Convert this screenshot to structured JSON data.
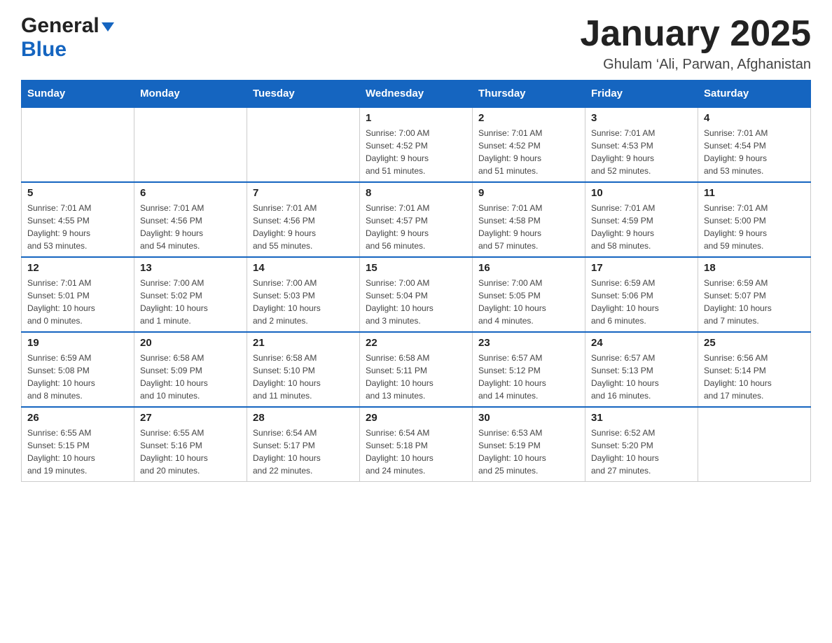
{
  "header": {
    "logo_general": "General",
    "logo_blue": "Blue",
    "month_title": "January 2025",
    "location": "Ghulam ‘Ali, Parwan, Afghanistan"
  },
  "days_of_week": [
    "Sunday",
    "Monday",
    "Tuesday",
    "Wednesday",
    "Thursday",
    "Friday",
    "Saturday"
  ],
  "weeks": [
    [
      {
        "day": "",
        "info": ""
      },
      {
        "day": "",
        "info": ""
      },
      {
        "day": "",
        "info": ""
      },
      {
        "day": "1",
        "info": "Sunrise: 7:00 AM\nSunset: 4:52 PM\nDaylight: 9 hours\nand 51 minutes."
      },
      {
        "day": "2",
        "info": "Sunrise: 7:01 AM\nSunset: 4:52 PM\nDaylight: 9 hours\nand 51 minutes."
      },
      {
        "day": "3",
        "info": "Sunrise: 7:01 AM\nSunset: 4:53 PM\nDaylight: 9 hours\nand 52 minutes."
      },
      {
        "day": "4",
        "info": "Sunrise: 7:01 AM\nSunset: 4:54 PM\nDaylight: 9 hours\nand 53 minutes."
      }
    ],
    [
      {
        "day": "5",
        "info": "Sunrise: 7:01 AM\nSunset: 4:55 PM\nDaylight: 9 hours\nand 53 minutes."
      },
      {
        "day": "6",
        "info": "Sunrise: 7:01 AM\nSunset: 4:56 PM\nDaylight: 9 hours\nand 54 minutes."
      },
      {
        "day": "7",
        "info": "Sunrise: 7:01 AM\nSunset: 4:56 PM\nDaylight: 9 hours\nand 55 minutes."
      },
      {
        "day": "8",
        "info": "Sunrise: 7:01 AM\nSunset: 4:57 PM\nDaylight: 9 hours\nand 56 minutes."
      },
      {
        "day": "9",
        "info": "Sunrise: 7:01 AM\nSunset: 4:58 PM\nDaylight: 9 hours\nand 57 minutes."
      },
      {
        "day": "10",
        "info": "Sunrise: 7:01 AM\nSunset: 4:59 PM\nDaylight: 9 hours\nand 58 minutes."
      },
      {
        "day": "11",
        "info": "Sunrise: 7:01 AM\nSunset: 5:00 PM\nDaylight: 9 hours\nand 59 minutes."
      }
    ],
    [
      {
        "day": "12",
        "info": "Sunrise: 7:01 AM\nSunset: 5:01 PM\nDaylight: 10 hours\nand 0 minutes."
      },
      {
        "day": "13",
        "info": "Sunrise: 7:00 AM\nSunset: 5:02 PM\nDaylight: 10 hours\nand 1 minute."
      },
      {
        "day": "14",
        "info": "Sunrise: 7:00 AM\nSunset: 5:03 PM\nDaylight: 10 hours\nand 2 minutes."
      },
      {
        "day": "15",
        "info": "Sunrise: 7:00 AM\nSunset: 5:04 PM\nDaylight: 10 hours\nand 3 minutes."
      },
      {
        "day": "16",
        "info": "Sunrise: 7:00 AM\nSunset: 5:05 PM\nDaylight: 10 hours\nand 4 minutes."
      },
      {
        "day": "17",
        "info": "Sunrise: 6:59 AM\nSunset: 5:06 PM\nDaylight: 10 hours\nand 6 minutes."
      },
      {
        "day": "18",
        "info": "Sunrise: 6:59 AM\nSunset: 5:07 PM\nDaylight: 10 hours\nand 7 minutes."
      }
    ],
    [
      {
        "day": "19",
        "info": "Sunrise: 6:59 AM\nSunset: 5:08 PM\nDaylight: 10 hours\nand 8 minutes."
      },
      {
        "day": "20",
        "info": "Sunrise: 6:58 AM\nSunset: 5:09 PM\nDaylight: 10 hours\nand 10 minutes."
      },
      {
        "day": "21",
        "info": "Sunrise: 6:58 AM\nSunset: 5:10 PM\nDaylight: 10 hours\nand 11 minutes."
      },
      {
        "day": "22",
        "info": "Sunrise: 6:58 AM\nSunset: 5:11 PM\nDaylight: 10 hours\nand 13 minutes."
      },
      {
        "day": "23",
        "info": "Sunrise: 6:57 AM\nSunset: 5:12 PM\nDaylight: 10 hours\nand 14 minutes."
      },
      {
        "day": "24",
        "info": "Sunrise: 6:57 AM\nSunset: 5:13 PM\nDaylight: 10 hours\nand 16 minutes."
      },
      {
        "day": "25",
        "info": "Sunrise: 6:56 AM\nSunset: 5:14 PM\nDaylight: 10 hours\nand 17 minutes."
      }
    ],
    [
      {
        "day": "26",
        "info": "Sunrise: 6:55 AM\nSunset: 5:15 PM\nDaylight: 10 hours\nand 19 minutes."
      },
      {
        "day": "27",
        "info": "Sunrise: 6:55 AM\nSunset: 5:16 PM\nDaylight: 10 hours\nand 20 minutes."
      },
      {
        "day": "28",
        "info": "Sunrise: 6:54 AM\nSunset: 5:17 PM\nDaylight: 10 hours\nand 22 minutes."
      },
      {
        "day": "29",
        "info": "Sunrise: 6:54 AM\nSunset: 5:18 PM\nDaylight: 10 hours\nand 24 minutes."
      },
      {
        "day": "30",
        "info": "Sunrise: 6:53 AM\nSunset: 5:19 PM\nDaylight: 10 hours\nand 25 minutes."
      },
      {
        "day": "31",
        "info": "Sunrise: 6:52 AM\nSunset: 5:20 PM\nDaylight: 10 hours\nand 27 minutes."
      },
      {
        "day": "",
        "info": ""
      }
    ]
  ]
}
